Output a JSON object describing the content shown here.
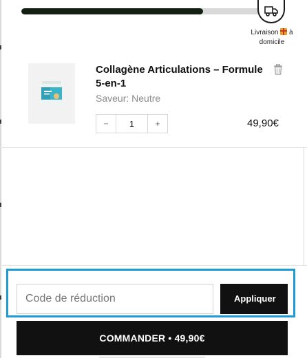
{
  "shipping": {
    "progress": 0.76,
    "label_before": "Livraison",
    "label_after": "à domicile"
  },
  "cart_item": {
    "title": "Collagène Articulations – Formule 5-en-1",
    "variant": "Saveur: Neutre",
    "quantity": "1",
    "decrease_label": "−",
    "increase_label": "+",
    "price": "49,90€"
  },
  "discount": {
    "placeholder": "Code de réduction",
    "apply_label": "Appliquer"
  },
  "checkout": {
    "label": "COMMANDER • 49,90€"
  },
  "colors": {
    "progress_fill": "#132013",
    "accent_frame": "#1e9bd7",
    "button_bg": "#111111"
  }
}
